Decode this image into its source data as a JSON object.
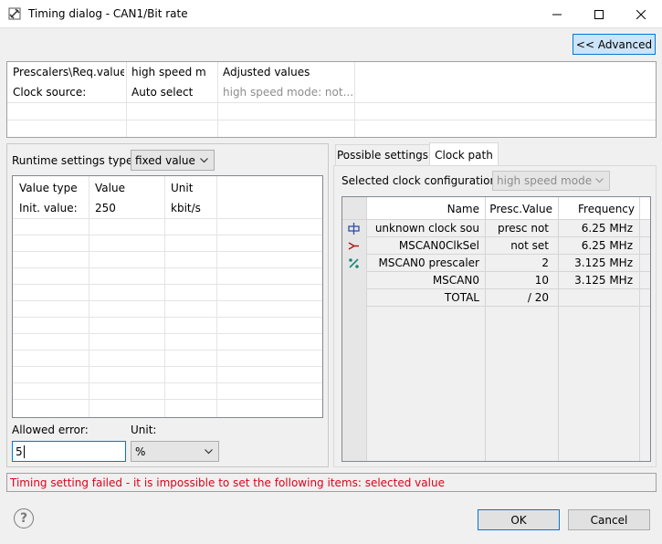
{
  "window": {
    "title": "Timing dialog - CAN1/Bit rate",
    "minimize": "—",
    "maximize": "☐",
    "close": "✕"
  },
  "advanced_button": "<< Advanced",
  "top_table": {
    "col1_header": "Prescalers\\Req.value",
    "col2_header": "high speed m",
    "col3_header": "Adjusted values",
    "row1_label": "Clock source:",
    "row1_value": "Auto select",
    "row1_adjusted": "high speed mode: not..."
  },
  "left_panel": {
    "runtime_label": "Runtime settings type:",
    "runtime_value": "fixed value",
    "table_headers": [
      "Value type",
      "Value",
      "Unit"
    ],
    "table_rows": [
      {
        "type": "Init. value:",
        "value": "250",
        "unit": "kbit/s"
      }
    ],
    "allowed_error_label": "Allowed error:",
    "allowed_error_value": "5",
    "unit_label": "Unit:",
    "unit_value": "%"
  },
  "right_panel": {
    "tabs": [
      "Possible settings",
      "Clock path"
    ],
    "active_tab": "Clock path",
    "clock_config_label": "Selected clock configuration",
    "clock_config_value": "high speed mode",
    "table_headers": [
      "Name",
      "Presc.Value",
      "Frequency"
    ],
    "rows": [
      {
        "icon": "clock-source-icon",
        "name": "unknown clock sou",
        "presc": "presc not",
        "freq": "6.25 MHz",
        "icon_color": "#2b4fa8"
      },
      {
        "icon": "clock-selector-icon",
        "name": "MSCAN0ClkSel",
        "presc": "not set",
        "freq": "6.25 MHz",
        "icon_color": "#b01c1c"
      },
      {
        "icon": "prescaler-icon",
        "name": "MSCAN0 prescaler",
        "presc": "2",
        "freq": "3.125 MHz",
        "icon_color": "#188a7a"
      },
      {
        "icon": "",
        "name": "MSCAN0",
        "presc": "10",
        "freq": "3.125 MHz"
      },
      {
        "icon": "",
        "name": "TOTAL",
        "presc": "/ 20",
        "freq": ""
      }
    ]
  },
  "status_message": "Timing setting failed - it is impossible to set the following items: selected value",
  "buttons": {
    "ok": "OK",
    "cancel": "Cancel",
    "help": "?"
  },
  "colors": {
    "error_text": "#e2001a",
    "accent": "#0078d7"
  }
}
